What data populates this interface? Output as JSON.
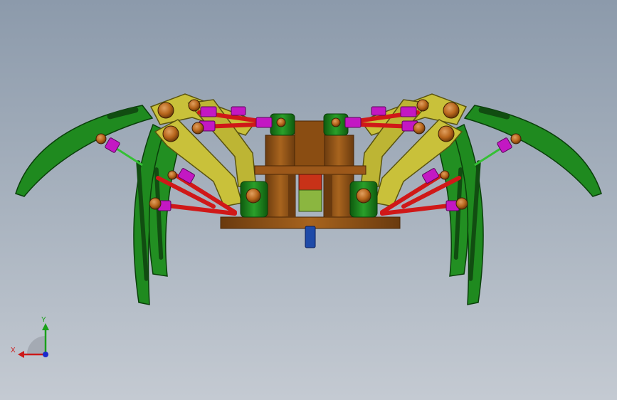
{
  "triad": {
    "x_label": "X",
    "y_label": "Y"
  },
  "colors": {
    "leg_green": "#1f8a1f",
    "leg_dark_green": "#0f5a0f",
    "bracket_yellow": "#c9c13a",
    "rod_red": "#d01818",
    "joint_magenta": "#c318c3",
    "pin_brown": "#b8661c",
    "frame_brown": "#8a4d12",
    "motor_red": "#c83218",
    "motor_green": "#8bb640",
    "shaft_blue": "#1e4aa8",
    "axis_x": "#cc1a1a",
    "axis_y": "#1aa01a",
    "axis_z": "#1a2acc"
  },
  "icons": {
    "triad": "view-orientation-triad-icon"
  }
}
